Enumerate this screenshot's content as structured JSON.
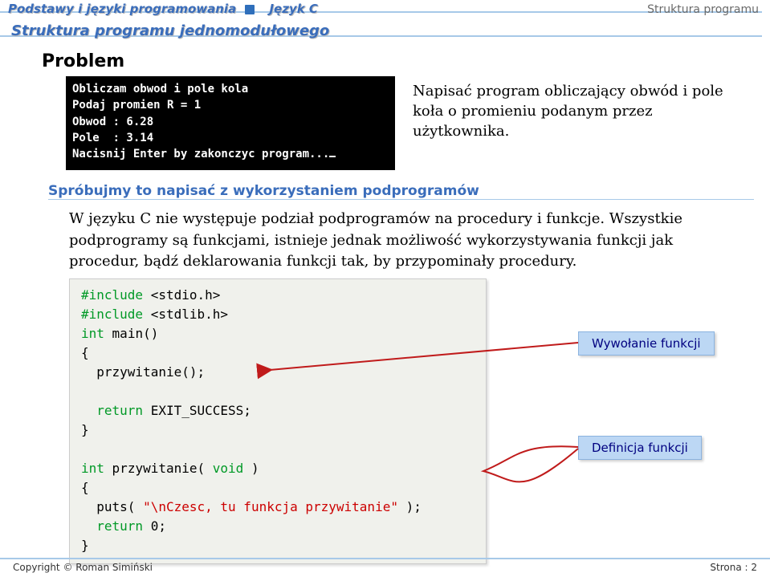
{
  "header": {
    "breadcrumb1": "Podstawy i języki programowania",
    "breadcrumb2": "Język C",
    "right": "Struktura programu"
  },
  "subtitle": "Struktura programu jednomodułowego",
  "section_title": "Problem",
  "console": {
    "line1": "Obliczam obwod i pole kola",
    "line2": "",
    "line3": "Podaj promien R = 1",
    "line4": "Obwod : 6.28",
    "line5": "Pole  : 3.14",
    "line6": "",
    "line7": "Nacisnij Enter by zakonczyc program..."
  },
  "desc_text": "Napisać program obliczający obwód i pole koła o promieniu podanym przez użytkownika.",
  "section_heading": "Spróbujmy to napisać z wykorzystaniem podprogramów",
  "body_text": "W języku C nie występuje podział podprogramów na procedury i funkcje. Wszystkie podprogramy są funkcjami, istnieje jednak możliwość wykorzystywania funkcji jak procedur, bądź deklarowania funkcji tak, by przypominały procedury.",
  "code": {
    "l1a": "#include",
    "l1b": "<stdio.h>",
    "l2a": "#include",
    "l2b": "<stdlib.h>",
    "l3a": "int",
    "l3b": "main()",
    "l4": "{",
    "l5": "  przywitanie();",
    "l6": " ",
    "l7a": "  return",
    "l7b": "EXIT_SUCCESS;",
    "l8": "}",
    "l9": " ",
    "l10a": "int",
    "l10b": "przywitanie(",
    "l10c": "void",
    "l10d": ")",
    "l11": "{",
    "l12a": "  puts(",
    "l12b": "\"\\nCzesc, tu funkcja przywitanie\"",
    "l12c": ");",
    "l13a": "  return",
    "l13b": "0;",
    "l14": "}"
  },
  "callouts": {
    "call": "Wywołanie funkcji",
    "def": "Definicja funkcji"
  },
  "footer": {
    "left": "Copyright © Roman Simiński",
    "right": "Strona : 2"
  }
}
